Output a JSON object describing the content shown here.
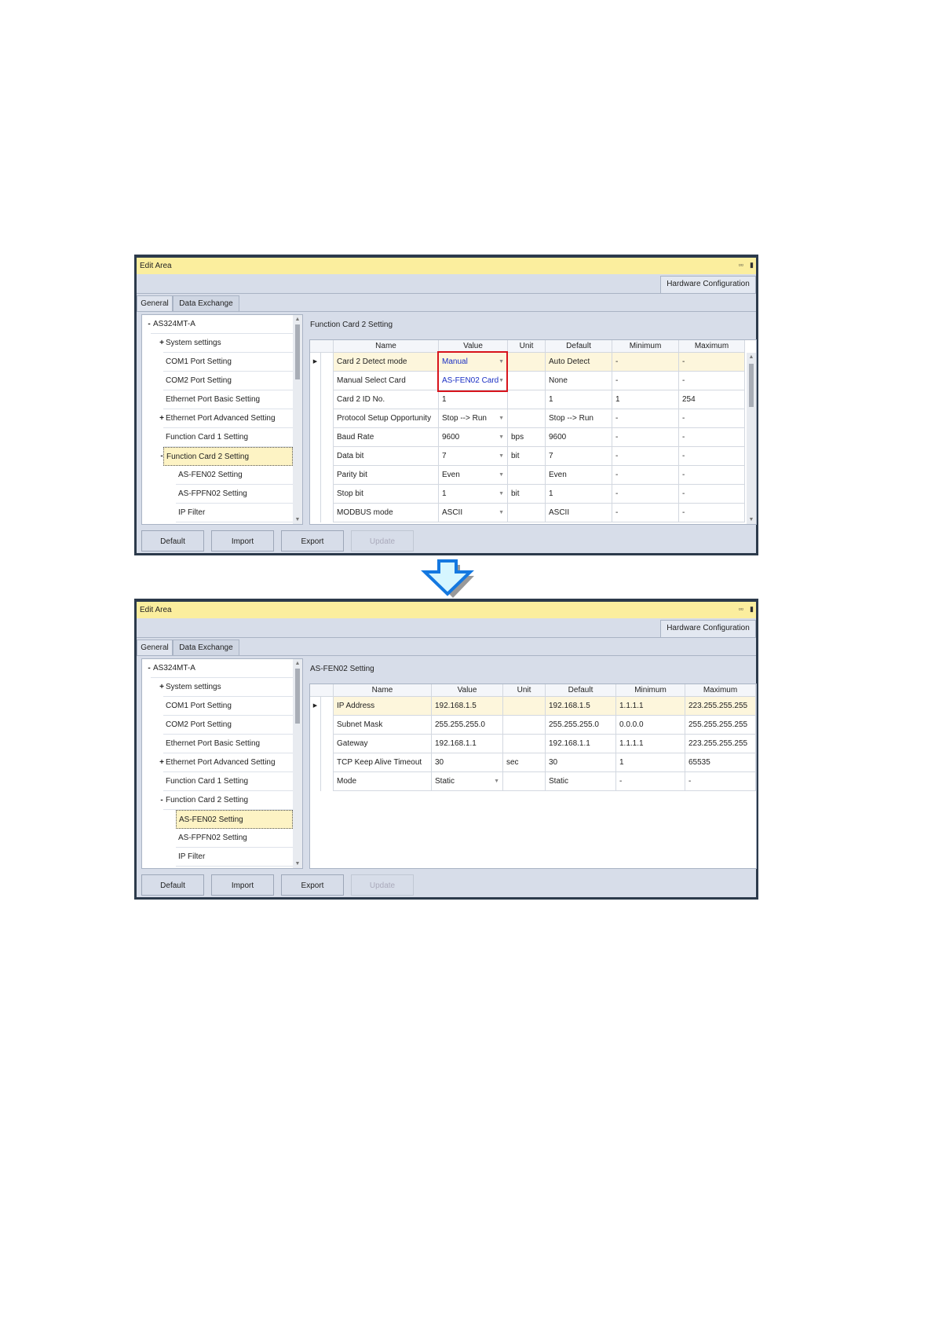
{
  "colors": {
    "title_bar": "#fbee9e",
    "frame": "#2c3a4b",
    "highlight_row": "#fdf6dc",
    "changed_value": "#1a2fc4",
    "callout": "#d8141c",
    "arrow": "#1478e0"
  },
  "panels": [
    {
      "title": "Edit Area",
      "window_icons": [
        "float-icon",
        "pin-icon"
      ],
      "hw_tab": "Hardware Configuration",
      "tabs": [
        "General",
        "Data Exchange"
      ],
      "tree": [
        {
          "label": "AS324MT-A",
          "level": 0,
          "marker": "-"
        },
        {
          "label": "System settings",
          "level": 1,
          "marker": "+"
        },
        {
          "label": "COM1 Port Setting",
          "level": 1,
          "marker": ""
        },
        {
          "label": "COM2 Port Setting",
          "level": 1,
          "marker": ""
        },
        {
          "label": "Ethernet Port Basic Setting",
          "level": 1,
          "marker": ""
        },
        {
          "label": "Ethernet Port Advanced Setting",
          "level": 1,
          "marker": "+"
        },
        {
          "label": "Function Card 1 Setting",
          "level": 1,
          "marker": ""
        },
        {
          "label": "Function Card 2 Setting",
          "level": 1,
          "marker": "-",
          "selected": true
        },
        {
          "label": "AS-FEN02 Setting",
          "level": 2,
          "marker": ""
        },
        {
          "label": "AS-FPFN02 Setting",
          "level": 2,
          "marker": ""
        },
        {
          "label": "IP Filter",
          "level": 2,
          "marker": ""
        }
      ],
      "grid_title": "Function Card 2 Setting",
      "columns": [
        "Name",
        "Value",
        "Unit",
        "Default",
        "Minimum",
        "Maximum"
      ],
      "rows": [
        {
          "name": "Card 2 Detect mode",
          "value": "Manual",
          "dropdown": true,
          "unit": "",
          "default": "Auto Detect",
          "min": "-",
          "max": "-",
          "changed": true
        },
        {
          "name": "Manual Select Card",
          "value": "AS-FEN02 Card",
          "dropdown": true,
          "unit": "",
          "default": "None",
          "min": "-",
          "max": "-",
          "changed": true
        },
        {
          "name": "Card 2 ID No.",
          "value": "1",
          "unit": "",
          "default": "1",
          "min": "1",
          "max": "254"
        },
        {
          "name": "Protocol Setup Opportunity",
          "value": "Stop --> Run",
          "dropdown": true,
          "unit": "",
          "default": "Stop --> Run",
          "min": "-",
          "max": "-"
        },
        {
          "name": "Baud Rate",
          "value": "9600",
          "dropdown": true,
          "unit": "bps",
          "default": "9600",
          "min": "-",
          "max": "-"
        },
        {
          "name": "Data bit",
          "value": "7",
          "dropdown": true,
          "unit": "bit",
          "default": "7",
          "min": "-",
          "max": "-"
        },
        {
          "name": "Parity bit",
          "value": "Even",
          "dropdown": true,
          "unit": "",
          "default": "Even",
          "min": "-",
          "max": "-"
        },
        {
          "name": "Stop bit",
          "value": "1",
          "dropdown": true,
          "unit": "bit",
          "default": "1",
          "min": "-",
          "max": "-"
        },
        {
          "name": "MODBUS mode",
          "value": "ASCII",
          "dropdown": true,
          "unit": "",
          "default": "ASCII",
          "min": "-",
          "max": "-"
        }
      ],
      "buttons": [
        {
          "label": "Default"
        },
        {
          "label": "Import"
        },
        {
          "label": "Export"
        },
        {
          "label": "Update",
          "disabled": true
        }
      ]
    },
    {
      "title": "Edit Area",
      "window_icons": [
        "float-icon",
        "pin-icon"
      ],
      "hw_tab": "Hardware Configuration",
      "tabs": [
        "General",
        "Data Exchange"
      ],
      "tree": [
        {
          "label": "AS324MT-A",
          "level": 0,
          "marker": "-"
        },
        {
          "label": "System settings",
          "level": 1,
          "marker": "+"
        },
        {
          "label": "COM1 Port Setting",
          "level": 1,
          "marker": ""
        },
        {
          "label": "COM2 Port Setting",
          "level": 1,
          "marker": ""
        },
        {
          "label": "Ethernet Port Basic Setting",
          "level": 1,
          "marker": ""
        },
        {
          "label": "Ethernet Port Advanced Setting",
          "level": 1,
          "marker": "+"
        },
        {
          "label": "Function Card 1 Setting",
          "level": 1,
          "marker": ""
        },
        {
          "label": "Function Card 2 Setting",
          "level": 1,
          "marker": "-"
        },
        {
          "label": "AS-FEN02 Setting",
          "level": 2,
          "marker": "",
          "selected": true
        },
        {
          "label": "AS-FPFN02 Setting",
          "level": 2,
          "marker": ""
        },
        {
          "label": "IP Filter",
          "level": 2,
          "marker": ""
        }
      ],
      "grid_title": "AS-FEN02 Setting",
      "columns": [
        "Name",
        "Value",
        "Unit",
        "Default",
        "Minimum",
        "Maximum"
      ],
      "rows": [
        {
          "name": "IP Address",
          "value": "192.168.1.5",
          "unit": "",
          "default": "192.168.1.5",
          "min": "1.1.1.1",
          "max": "223.255.255.255"
        },
        {
          "name": "Subnet Mask",
          "value": "255.255.255.0",
          "unit": "",
          "default": "255.255.255.0",
          "min": "0.0.0.0",
          "max": "255.255.255.255"
        },
        {
          "name": "Gateway",
          "value": "192.168.1.1",
          "unit": "",
          "default": "192.168.1.1",
          "min": "1.1.1.1",
          "max": "223.255.255.255"
        },
        {
          "name": "TCP Keep Alive Timeout",
          "value": "30",
          "unit": "sec",
          "default": "30",
          "min": "1",
          "max": "65535"
        },
        {
          "name": "Mode",
          "value": "Static",
          "dropdown": true,
          "unit": "",
          "default": "Static",
          "min": "-",
          "max": "-"
        }
      ],
      "buttons": [
        {
          "label": "Default"
        },
        {
          "label": "Import"
        },
        {
          "label": "Export"
        },
        {
          "label": "Update",
          "disabled": true
        }
      ]
    }
  ]
}
